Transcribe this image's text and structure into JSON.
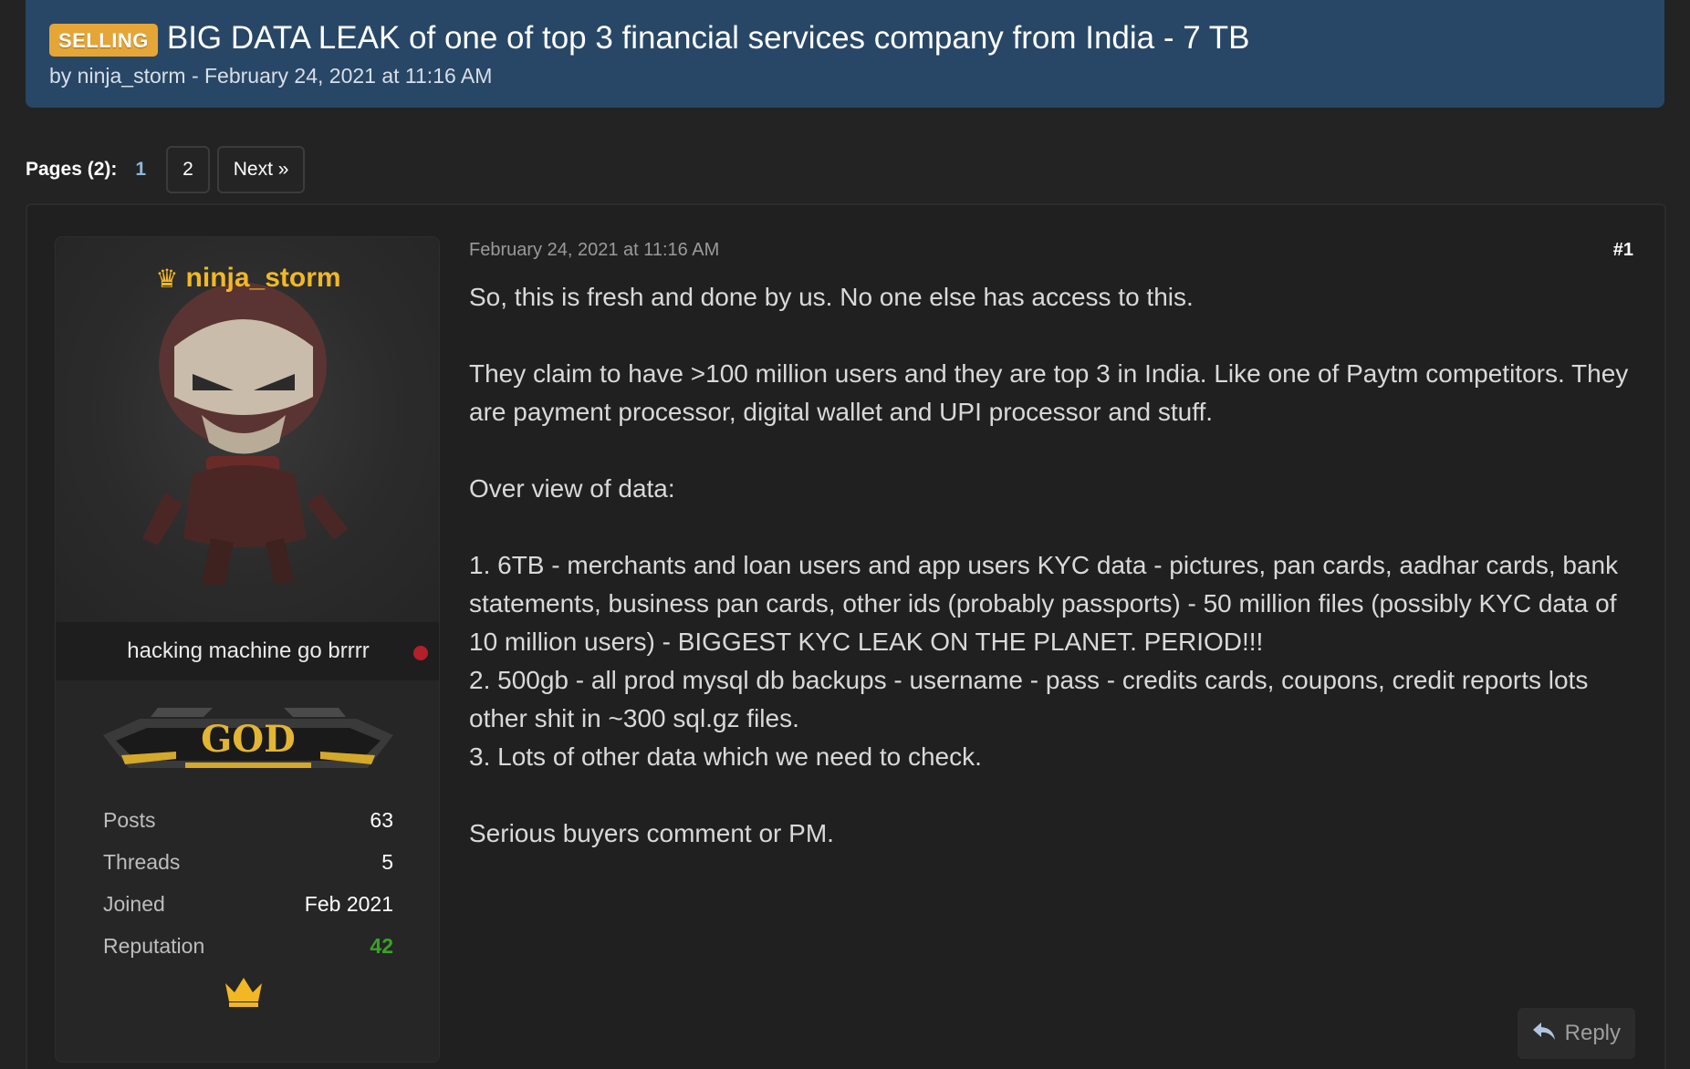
{
  "thread": {
    "badge": "SELLING",
    "title": "BIG DATA LEAK of one of top 3 financial services company from India - 7 TB",
    "meta": "by ninja_storm - February 24, 2021 at 11:16 AM"
  },
  "pagination": {
    "label": "Pages (2):",
    "current": "1",
    "page2": "2",
    "next": "Next »"
  },
  "post": {
    "date": "February 24, 2021 at 11:16 AM",
    "number": "#1",
    "paragraphs": [
      "So, this is fresh and done by us. No one else has access to this.",
      "They claim to have >100 million users and they are top 3 in India. Like one of Paytm competitors. They are payment processor, digital wallet and UPI processor and stuff.",
      "Over view of data:",
      "1. 6TB - merchants and loan users and app users KYC data - pictures, pan cards, aadhar cards, bank statements, business pan cards, other ids (probably passports) - 50 million files (possibly KYC data of 10 million users) - BIGGEST KYC LEAK ON THE PLANET. PERIOD!!!",
      "2. 500gb - all prod mysql db backups - username - pass - credits cards, coupons, credit reports lots other shit in ~300 sql.gz files.",
      "3. Lots of other data which we need to check.",
      "Serious buyers comment or PM."
    ],
    "reply_label": "Reply"
  },
  "author": {
    "name": "ninja_storm",
    "usertitle": "hacking machine go brrrr",
    "rank": "GOD",
    "stats": {
      "posts_label": "Posts",
      "posts": "63",
      "threads_label": "Threads",
      "threads": "5",
      "joined_label": "Joined",
      "joined": "Feb 2021",
      "reputation_label": "Reputation",
      "reputation": "42"
    },
    "status_color": "#b3202a"
  },
  "colors": {
    "header_bg": "#284766",
    "badge_bg": "#e5a637",
    "username": "#f2b824",
    "reputation": "#3aa325",
    "page_bg": "#232323"
  },
  "icons": [
    "crown-icon",
    "reply-icon",
    "online-status-dot"
  ]
}
